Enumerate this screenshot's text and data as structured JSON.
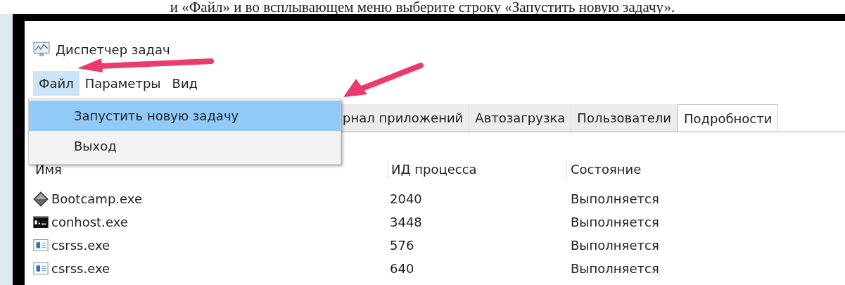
{
  "caption": "и «Файл» и во всплывающем меню выберите строку «Запустить новую задачу».",
  "window": {
    "title": "Диспетчер задач"
  },
  "menubar": [
    {
      "label": "Файл",
      "selected": true
    },
    {
      "label": "Параметры",
      "selected": false
    },
    {
      "label": "Вид",
      "selected": false
    }
  ],
  "menu": {
    "items": [
      {
        "label": "Запустить новую задачу",
        "selected": true
      },
      {
        "label": "Выход",
        "selected": false
      }
    ]
  },
  "tabs": [
    {
      "label": "рнал приложений",
      "selected": false
    },
    {
      "label": "Автозагрузка",
      "selected": false
    },
    {
      "label": "Пользователи",
      "selected": false
    },
    {
      "label": "Подробности",
      "selected": true
    }
  ],
  "table": {
    "columns": [
      "Имя",
      "ИД процесса",
      "Состояние"
    ],
    "rows": [
      {
        "kind": "diamond",
        "name": "Bootcamp.exe",
        "pid": "2040",
        "status": "Выполняется"
      },
      {
        "kind": "console",
        "name": "conhost.exe",
        "pid": "3448",
        "status": "Выполняется"
      },
      {
        "kind": "window",
        "name": "csrss.exe",
        "pid": "576",
        "status": "Выполняется"
      },
      {
        "kind": "window",
        "name": "csrss.exe",
        "pid": "640",
        "status": "Выполняется"
      }
    ]
  }
}
